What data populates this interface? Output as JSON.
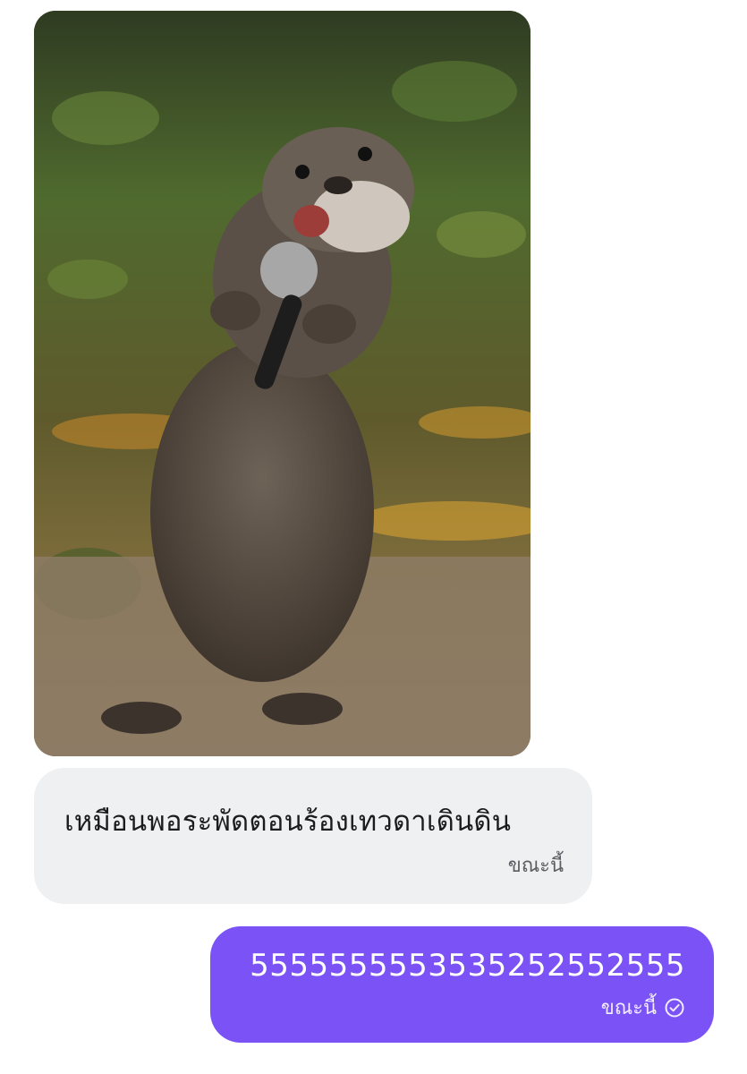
{
  "chat": {
    "image_message": {
      "alt_label": "otter-singing-photo"
    },
    "incoming": {
      "text": "เหมือนพอระพัดตอนร้องเทวดาเดินดิน",
      "time": "ขณะนี้"
    },
    "outgoing": {
      "text": "5555555553535252552555",
      "time": "ขณะนี้",
      "status_icon": "read-check-circle-icon"
    }
  },
  "colors": {
    "incoming_bubble": "#eef0f1",
    "outgoing_bubble": "#7a52f5",
    "outgoing_text": "#ffffff"
  }
}
